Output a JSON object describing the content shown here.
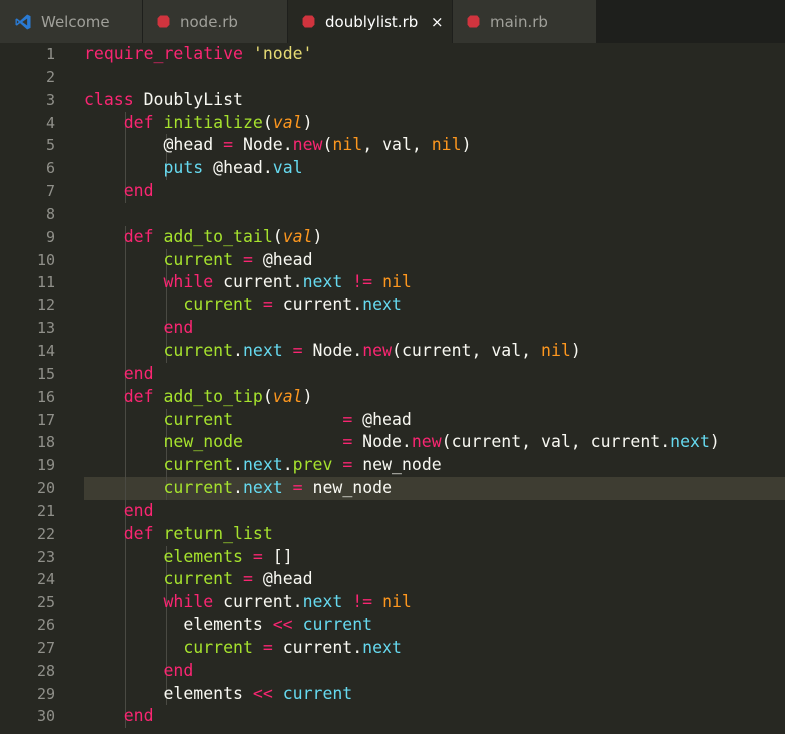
{
  "tabs": [
    {
      "label": "Welcome",
      "icon": "vscode-icon",
      "active": false
    },
    {
      "label": "node.rb",
      "icon": "ruby-icon",
      "active": false
    },
    {
      "label": "doublylist.rb",
      "icon": "ruby-icon",
      "active": true,
      "close": "×"
    },
    {
      "label": "main.rb",
      "icon": "ruby-icon",
      "active": false
    }
  ],
  "colors": {
    "background": "#272822",
    "tabbar": "#1e1f1c",
    "keyword": "#f92672",
    "function": "#a6e22e",
    "string": "#e6db74",
    "member": "#66d9ef",
    "nil": "#fd971f",
    "ruby_icon": "#d0343e",
    "vscode_icon": "#2a7ad3"
  },
  "editor": {
    "current_line": 20,
    "lines": [
      {
        "n": "1",
        "indent": 0,
        "tokens": [
          [
            "kw",
            "require_relative"
          ],
          [
            "plain",
            " "
          ],
          [
            "str",
            "'node'"
          ]
        ]
      },
      {
        "n": "2",
        "indent": 0,
        "tokens": []
      },
      {
        "n": "3",
        "indent": 0,
        "tokens": [
          [
            "kw",
            "class"
          ],
          [
            "plain",
            " DoublyList"
          ]
        ]
      },
      {
        "n": "4",
        "indent": 1,
        "tokens": [
          [
            "kw",
            "def"
          ],
          [
            "plain",
            " "
          ],
          [
            "fn",
            "initialize"
          ],
          [
            "plain",
            "("
          ],
          [
            "par",
            "val"
          ],
          [
            "plain",
            ")"
          ]
        ]
      },
      {
        "n": "5",
        "indent": 2,
        "tokens": [
          [
            "ivar",
            "@head"
          ],
          [
            "plain",
            " "
          ],
          [
            "op",
            "="
          ],
          [
            "plain",
            " Node."
          ],
          [
            "new",
            "new"
          ],
          [
            "plain",
            "("
          ],
          [
            "nil",
            "nil"
          ],
          [
            "plain",
            ", val, "
          ],
          [
            "nil",
            "nil"
          ],
          [
            "plain",
            ")"
          ]
        ]
      },
      {
        "n": "6",
        "indent": 2,
        "tokens": [
          [
            "mem",
            "puts"
          ],
          [
            "plain",
            " @head."
          ],
          [
            "mem",
            "val"
          ]
        ]
      },
      {
        "n": "7",
        "indent": 1,
        "tokens": [
          [
            "kw",
            "end"
          ]
        ]
      },
      {
        "n": "8",
        "indent": 0,
        "tokens": []
      },
      {
        "n": "9",
        "indent": 1,
        "tokens": [
          [
            "kw",
            "def"
          ],
          [
            "plain",
            " "
          ],
          [
            "fn",
            "add_to_tail"
          ],
          [
            "plain",
            "("
          ],
          [
            "par",
            "val"
          ],
          [
            "plain",
            ")"
          ]
        ]
      },
      {
        "n": "10",
        "indent": 2,
        "tokens": [
          [
            "fn",
            "current"
          ],
          [
            "plain",
            " "
          ],
          [
            "op",
            "="
          ],
          [
            "plain",
            " @head"
          ]
        ]
      },
      {
        "n": "11",
        "indent": 2,
        "tokens": [
          [
            "kw",
            "while"
          ],
          [
            "plain",
            " current."
          ],
          [
            "mem",
            "next"
          ],
          [
            "plain",
            " "
          ],
          [
            "op",
            "!="
          ],
          [
            "plain",
            " "
          ],
          [
            "nil",
            "nil"
          ]
        ]
      },
      {
        "n": "12",
        "indent": 3,
        "tokens": [
          [
            "fn",
            "current"
          ],
          [
            "plain",
            " "
          ],
          [
            "op",
            "="
          ],
          [
            "plain",
            " current."
          ],
          [
            "mem",
            "next"
          ]
        ]
      },
      {
        "n": "13",
        "indent": 2,
        "tokens": [
          [
            "kw",
            "end"
          ]
        ]
      },
      {
        "n": "14",
        "indent": 2,
        "tokens": [
          [
            "fn",
            "current"
          ],
          [
            "plain",
            "."
          ],
          [
            "mem",
            "next"
          ],
          [
            "plain",
            " "
          ],
          [
            "op",
            "="
          ],
          [
            "plain",
            " Node."
          ],
          [
            "new",
            "new"
          ],
          [
            "plain",
            "(current, val, "
          ],
          [
            "nil",
            "nil"
          ],
          [
            "plain",
            ")"
          ]
        ]
      },
      {
        "n": "15",
        "indent": 1,
        "tokens": [
          [
            "kw",
            "end"
          ]
        ]
      },
      {
        "n": "16",
        "indent": 1,
        "tokens": [
          [
            "kw",
            "def"
          ],
          [
            "plain",
            " "
          ],
          [
            "fn",
            "add_to_tip"
          ],
          [
            "plain",
            "("
          ],
          [
            "par",
            "val"
          ],
          [
            "plain",
            ")"
          ]
        ]
      },
      {
        "n": "17",
        "indent": 2,
        "tokens": [
          [
            "fn",
            "current"
          ],
          [
            "plain",
            "           "
          ],
          [
            "op",
            "="
          ],
          [
            "plain",
            " @head"
          ]
        ]
      },
      {
        "n": "18",
        "indent": 2,
        "tokens": [
          [
            "fn",
            "new_node"
          ],
          [
            "plain",
            "          "
          ],
          [
            "op",
            "="
          ],
          [
            "plain",
            " Node."
          ],
          [
            "new",
            "new"
          ],
          [
            "plain",
            "(current, val, current."
          ],
          [
            "mem",
            "next"
          ],
          [
            "plain",
            ")"
          ]
        ]
      },
      {
        "n": "19",
        "indent": 2,
        "tokens": [
          [
            "fn",
            "current"
          ],
          [
            "plain",
            "."
          ],
          [
            "mem",
            "next"
          ],
          [
            "plain",
            "."
          ],
          [
            "fn",
            "prev"
          ],
          [
            "plain",
            " "
          ],
          [
            "op",
            "="
          ],
          [
            "plain",
            " new_node"
          ]
        ]
      },
      {
        "n": "20",
        "indent": 2,
        "tokens": [
          [
            "fn",
            "current"
          ],
          [
            "plain",
            "."
          ],
          [
            "mem",
            "next"
          ],
          [
            "plain",
            " "
          ],
          [
            "op",
            "="
          ],
          [
            "plain",
            " new_node"
          ]
        ]
      },
      {
        "n": "21",
        "indent": 1,
        "tokens": [
          [
            "kw",
            "end"
          ]
        ]
      },
      {
        "n": "22",
        "indent": 1,
        "tokens": [
          [
            "kw",
            "def"
          ],
          [
            "plain",
            " "
          ],
          [
            "fn",
            "return_list"
          ]
        ]
      },
      {
        "n": "23",
        "indent": 2,
        "tokens": [
          [
            "fn",
            "elements"
          ],
          [
            "plain",
            " "
          ],
          [
            "op",
            "="
          ],
          [
            "plain",
            " []"
          ]
        ]
      },
      {
        "n": "24",
        "indent": 2,
        "tokens": [
          [
            "fn",
            "current"
          ],
          [
            "plain",
            " "
          ],
          [
            "op",
            "="
          ],
          [
            "plain",
            " @head"
          ]
        ]
      },
      {
        "n": "25",
        "indent": 2,
        "tokens": [
          [
            "kw",
            "while"
          ],
          [
            "plain",
            " current."
          ],
          [
            "mem",
            "next"
          ],
          [
            "plain",
            " "
          ],
          [
            "op",
            "!="
          ],
          [
            "plain",
            " "
          ],
          [
            "nil",
            "nil"
          ]
        ]
      },
      {
        "n": "26",
        "indent": 3,
        "tokens": [
          [
            "plain",
            "elements "
          ],
          [
            "op",
            "<<"
          ],
          [
            "plain",
            " "
          ],
          [
            "mem",
            "current"
          ]
        ]
      },
      {
        "n": "27",
        "indent": 3,
        "tokens": [
          [
            "fn",
            "current"
          ],
          [
            "plain",
            " "
          ],
          [
            "op",
            "="
          ],
          [
            "plain",
            " current."
          ],
          [
            "mem",
            "next"
          ]
        ]
      },
      {
        "n": "28",
        "indent": 2,
        "tokens": [
          [
            "kw",
            "end"
          ]
        ]
      },
      {
        "n": "29",
        "indent": 2,
        "tokens": [
          [
            "plain",
            "elements "
          ],
          [
            "op",
            "<<"
          ],
          [
            "plain",
            " "
          ],
          [
            "mem",
            "current"
          ]
        ]
      },
      {
        "n": "30",
        "indent": 1,
        "tokens": [
          [
            "kw",
            "end"
          ]
        ]
      }
    ]
  }
}
